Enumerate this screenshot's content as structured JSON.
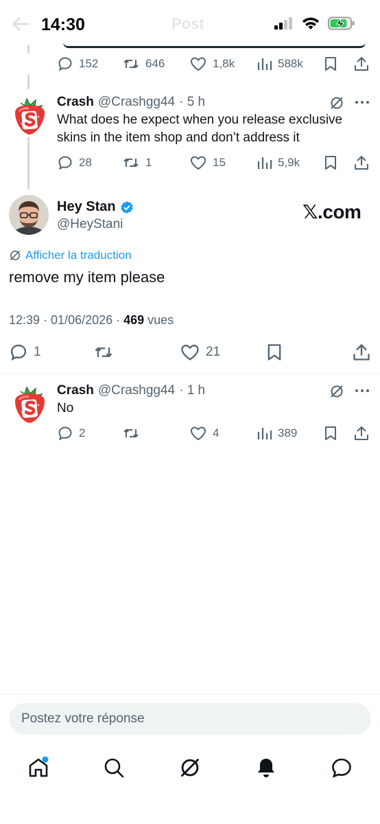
{
  "status_bar": {
    "time": "14:30",
    "header_title": "Post"
  },
  "quoted_tweet": {
    "replies": "152",
    "reposts": "646",
    "likes": "1,8k",
    "views": "588k"
  },
  "reply1": {
    "name": "Crash",
    "handle": "@Crashgg44",
    "time": "· 5 h",
    "text_line1": "What does he expect when you release exclusive",
    "text_line2": "skins in the item shop and don’t address it",
    "replies": "28",
    "reposts": "1",
    "likes": "15",
    "views": "5,9k"
  },
  "main_tweet": {
    "name": "Hey Stan",
    "handle": "@HeyStani",
    "watermark": "𝕏.com",
    "translate_label": "Afficher la traduction",
    "text": "remove my item please",
    "timestamp": "12:39 · 01/06/2026 · ",
    "views_count": "469",
    "views_label": " vues",
    "replies": "1",
    "likes": "21"
  },
  "reply2": {
    "name": "Crash",
    "handle": "@Crashgg44",
    "time": "· 1 h",
    "text": "No",
    "replies": "2",
    "likes": "4",
    "views": "389"
  },
  "composer": {
    "placeholder": "Postez votre réponse"
  },
  "colors": {
    "accent": "#1d9bf0",
    "muted": "#536471",
    "text": "#0f1419"
  },
  "tabbar": {
    "icons": [
      "home-icon",
      "search-icon",
      "grok-icon",
      "notifications-icon",
      "messages-icon"
    ]
  }
}
